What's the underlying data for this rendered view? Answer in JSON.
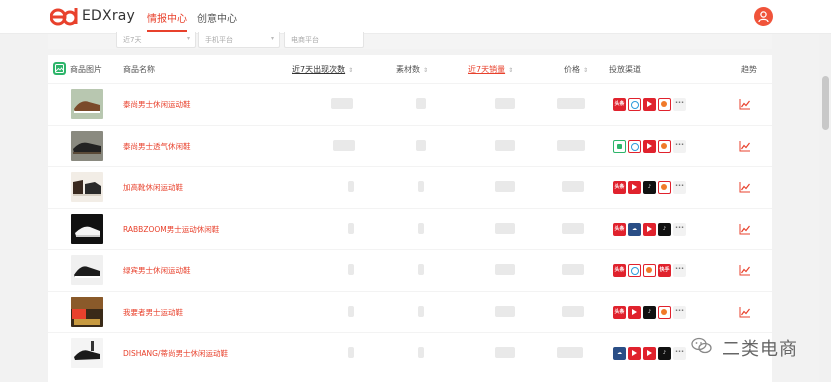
{
  "app": {
    "brand": "EDXray",
    "nav": [
      {
        "label": "情报中心",
        "active": true
      },
      {
        "label": "创意中心",
        "active": false
      }
    ],
    "accent": "#e8412c"
  },
  "filters": {
    "time_value": "近7天",
    "category_value": "手机平台",
    "platform_value": "电商平台"
  },
  "table": {
    "headers": {
      "image": "商品图片",
      "name": "商品名称",
      "appearances": "近7天出现次数",
      "materials": "素材数",
      "sales": "近7天销量",
      "price": "价格",
      "channels": "投放渠道",
      "trend": "趋势"
    },
    "rows": [
      {
        "name": "泰尚男士休闲运动鞋",
        "channels": [
          "tt",
          "wb",
          "ps",
          "ks",
          "more"
        ]
      },
      {
        "name": "泰尚男士透气休闲鞋",
        "channels": [
          "wx",
          "wb",
          "ps",
          "ks",
          "more"
        ]
      },
      {
        "name": "加高靴休闲运动鞋",
        "channels": [
          "tt",
          "ps",
          "dy",
          "ks",
          "more"
        ]
      },
      {
        "name": "RABBZOOM男士运动休闲鞋",
        "channels": [
          "tt",
          "yt",
          "ps",
          "dy",
          "more"
        ]
      },
      {
        "name": "绿宾男士休闲运动鞋",
        "channels": [
          "tt",
          "wb",
          "ks",
          "ks",
          "more"
        ]
      },
      {
        "name": "我要者男士运动鞋",
        "channels": [
          "tt",
          "ps",
          "dy",
          "ks",
          "more"
        ]
      },
      {
        "name": "DISHANG/蒂尚男士休闲运动鞋",
        "channels": [
          "yt",
          "ps",
          "ps",
          "dy",
          "more"
        ]
      }
    ]
  },
  "channel_labels": {
    "tt": "头条",
    "ks": "快手"
  },
  "watermark": {
    "text": "二类电商"
  }
}
